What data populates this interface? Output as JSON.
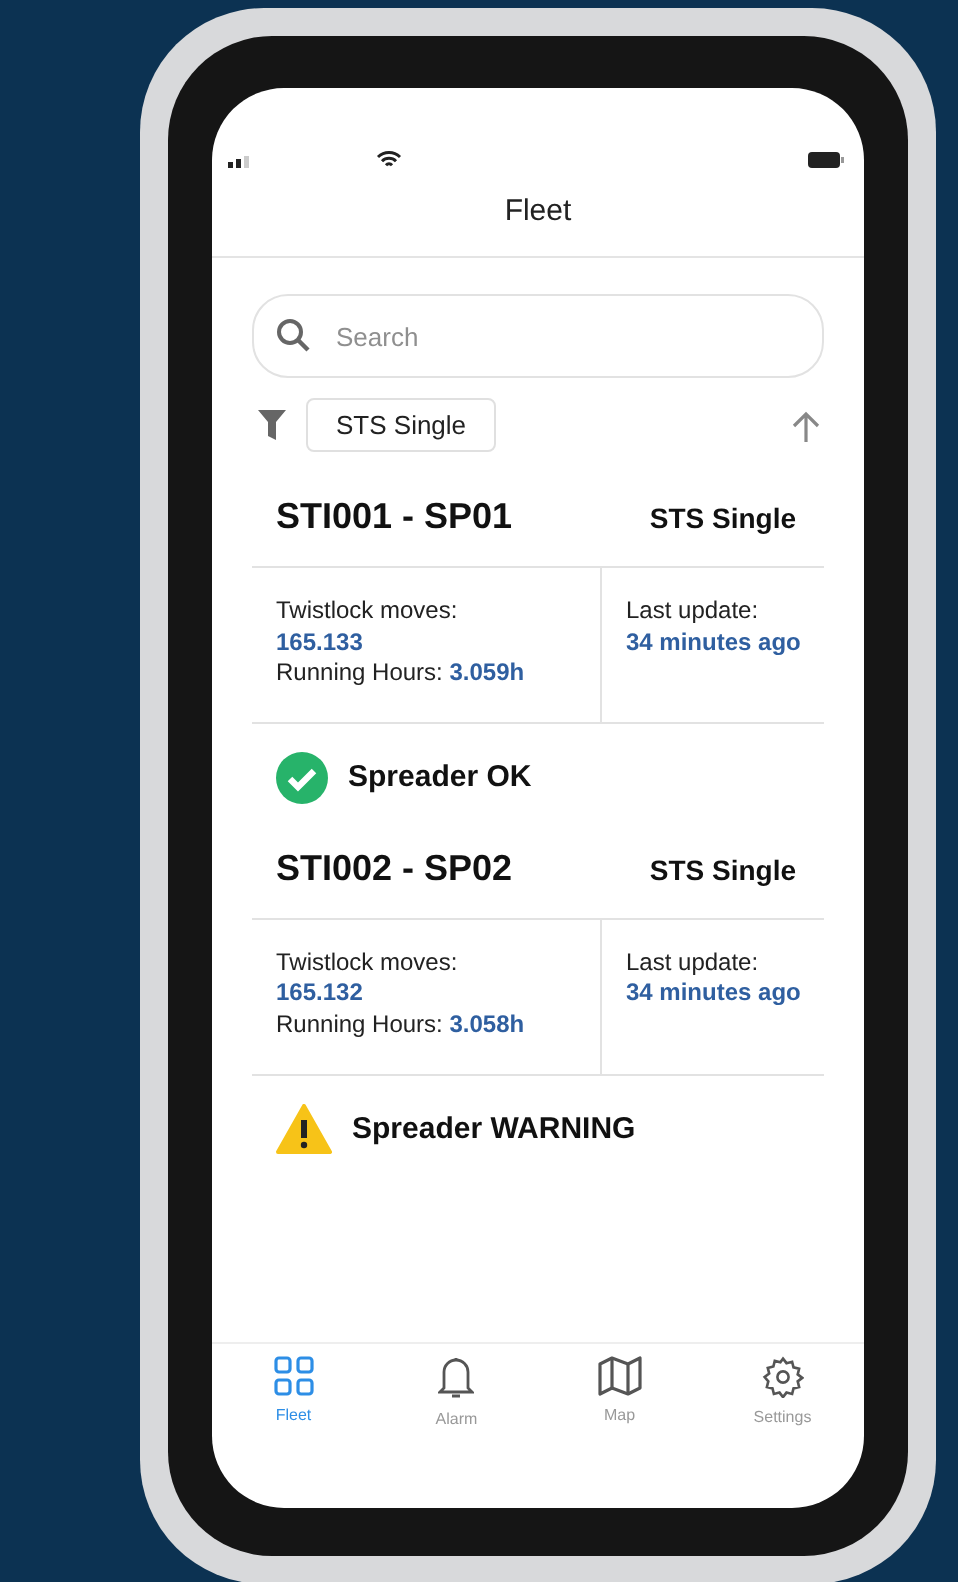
{
  "header": {
    "title": "Fleet"
  },
  "search": {
    "placeholder": "Search"
  },
  "filter": {
    "chip": "STS Single"
  },
  "spreaders": [
    {
      "name": "STI001 - SP01",
      "type": "STS Single",
      "twistlock_label": "Twistlock moves:",
      "twistlock_value": "165.133",
      "hours_label": "Running Hours:",
      "hours_value": "3.059h",
      "update_label": "Last update:",
      "update_value": "34 minutes ago",
      "status": {
        "kind": "ok",
        "label": "Spreader OK"
      }
    },
    {
      "name": "STI002 - SP02",
      "type": "STS Single",
      "twistlock_label": "Twistlock moves:",
      "twistlock_value": "165.132",
      "hours_label": "Running Hours:",
      "hours_value": "3.058h",
      "update_label": "Last update:",
      "update_value": "34 minutes ago",
      "status": {
        "kind": "warning",
        "label": "Spreader WARNING"
      }
    }
  ],
  "tab_bar": [
    {
      "kind": "fleet",
      "label": "Fleet",
      "selected": true
    },
    {
      "kind": "alarm",
      "label": "Alarm",
      "selected": false
    },
    {
      "kind": "map",
      "label": "Map",
      "selected": false
    },
    {
      "kind": "settings",
      "label": "Settings",
      "selected": false
    }
  ]
}
